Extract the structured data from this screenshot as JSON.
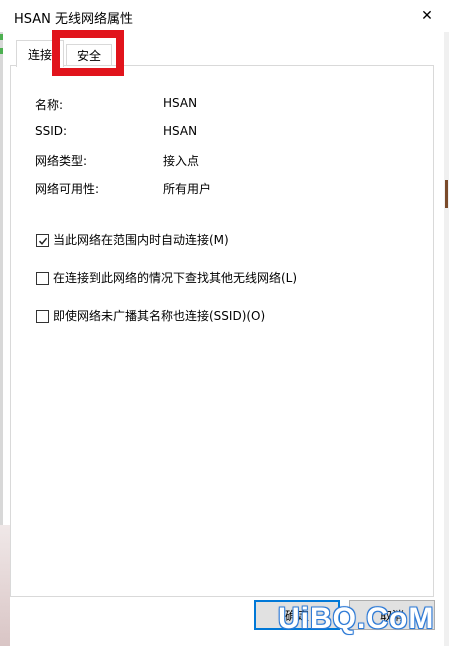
{
  "window": {
    "title": "HSAN 无线网络属性",
    "close_symbol": "✕"
  },
  "tabs": [
    {
      "label": "连接",
      "selected": true
    },
    {
      "label": "安全",
      "selected": false,
      "highlighted": true
    }
  ],
  "highlight_color": "#e1141c",
  "properties": [
    {
      "label": "名称:",
      "value": "HSAN"
    },
    {
      "label": "SSID:",
      "value": "HSAN"
    },
    {
      "label": "网络类型:",
      "value": "接入点"
    },
    {
      "label": "网络可用性:",
      "value": "所有用户"
    }
  ],
  "checkboxes": [
    {
      "label": "当此网络在范围内时自动连接(M)",
      "checked": true
    },
    {
      "label": "在连接到此网络的情况下查找其他无线网络(L)",
      "checked": false
    },
    {
      "label": "即使网络未广播其名称也连接(SSID)(O)",
      "checked": false
    }
  ],
  "buttons": {
    "ok": "确定",
    "cancel": "取消"
  },
  "watermark": "UiBQ.CoM"
}
